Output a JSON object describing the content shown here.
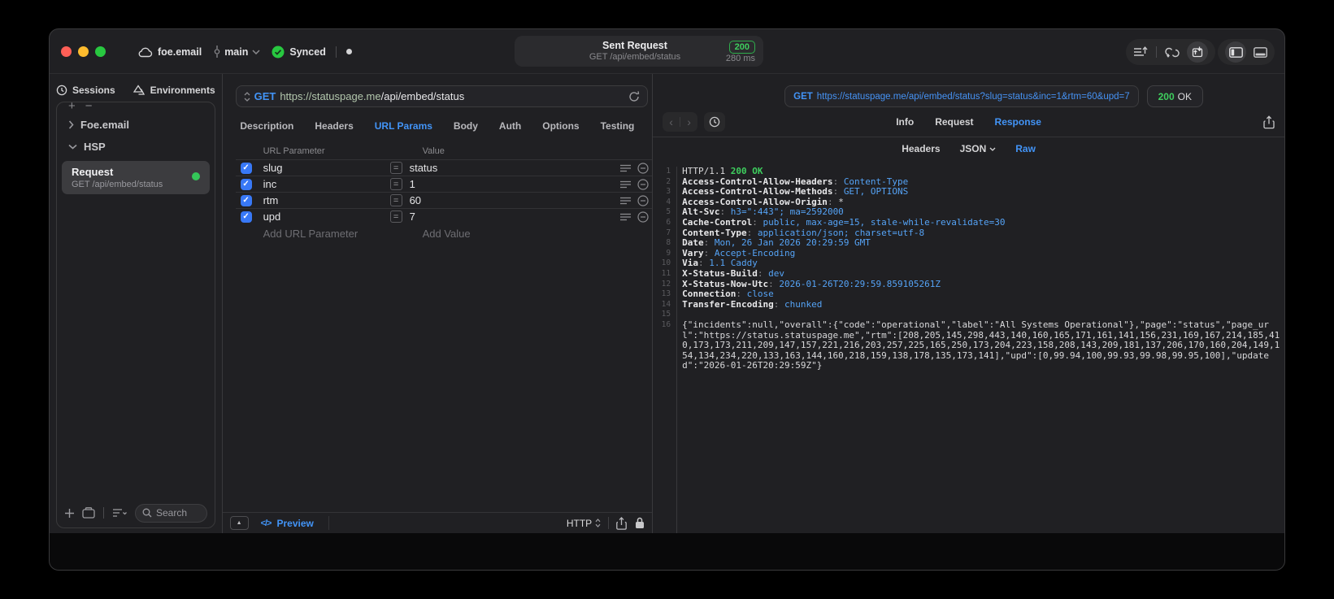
{
  "titlebar": {
    "workspace": "foe.email",
    "branch": "main",
    "sync_status": "Synced",
    "request_title": "Sent Request",
    "request_subtitle": "GET /api/embed/status",
    "status_code": "200",
    "duration": "280 ms"
  },
  "sidebar": {
    "tabs": [
      {
        "label": "Sessions"
      },
      {
        "label": "Environments"
      }
    ],
    "add_label": "+",
    "remove_label": "−",
    "tree": [
      {
        "label": "Foe.email"
      },
      {
        "label": "HSP"
      }
    ],
    "selected_request": {
      "title": "Request",
      "subtitle": "GET /api/embed/status"
    },
    "search_placeholder": "Search"
  },
  "request_panel": {
    "method": "GET",
    "url_host": "https://statuspage.me",
    "url_path": "/api/embed/status",
    "tabs": [
      "Description",
      "Headers",
      "URL Params",
      "Body",
      "Auth",
      "Options",
      "Testing"
    ],
    "active_tab": "URL Params",
    "table": {
      "columns": [
        "URL Parameter",
        "Value"
      ],
      "rows": [
        {
          "name": "slug",
          "value": "status",
          "enabled": true
        },
        {
          "name": "inc",
          "value": "1",
          "enabled": true
        },
        {
          "name": "rtm",
          "value": "60",
          "enabled": true
        },
        {
          "name": "upd",
          "value": "7",
          "enabled": true
        }
      ],
      "add_name_placeholder": "Add URL Parameter",
      "add_value_placeholder": "Add Value"
    },
    "footer": {
      "preview_label": "Preview",
      "code_glyph": "</>",
      "protocol": "HTTP"
    }
  },
  "response_panel": {
    "method": "GET",
    "url": "https://statuspage.me/api/embed/status?slug=status&inc=1&rtm=60&upd=7",
    "status_code": "200",
    "status_text": "OK",
    "tabs": [
      "Info",
      "Request",
      "Response"
    ],
    "active_tab": "Response",
    "subtabs": [
      "Headers",
      "JSON",
      "Raw"
    ],
    "active_subtab": "Raw",
    "body_lines": [
      {
        "n": "1",
        "segs": [
          [
            "HTTP/1.1 ",
            "plain"
          ],
          [
            "200 OK",
            "green"
          ]
        ]
      },
      {
        "n": "2",
        "segs": [
          [
            "Access-Control-Allow-Headers",
            "name"
          ],
          [
            ": ",
            "dim"
          ],
          [
            "Content-Type",
            "val"
          ]
        ]
      },
      {
        "n": "3",
        "segs": [
          [
            "Access-Control-Allow-Methods",
            "name"
          ],
          [
            ": ",
            "dim"
          ],
          [
            "GET, OPTIONS",
            "val"
          ]
        ]
      },
      {
        "n": "4",
        "segs": [
          [
            "Access-Control-Allow-Origin",
            "name"
          ],
          [
            ": ",
            "dim"
          ],
          [
            "*",
            "plain"
          ]
        ]
      },
      {
        "n": "5",
        "segs": [
          [
            "Alt-Svc",
            "name"
          ],
          [
            ": ",
            "dim"
          ],
          [
            "h3=\":443\"; ma=2592000",
            "val"
          ]
        ]
      },
      {
        "n": "6",
        "segs": [
          [
            "Cache-Control",
            "name"
          ],
          [
            ": ",
            "dim"
          ],
          [
            "public, max-age=15, stale-while-revalidate=30",
            "val"
          ]
        ]
      },
      {
        "n": "7",
        "segs": [
          [
            "Content-Type",
            "name"
          ],
          [
            ": ",
            "dim"
          ],
          [
            "application/json; charset=utf-8",
            "val"
          ]
        ]
      },
      {
        "n": "8",
        "segs": [
          [
            "Date",
            "name"
          ],
          [
            ": ",
            "dim"
          ],
          [
            "Mon, 26 Jan 2026 20:29:59 GMT",
            "val"
          ]
        ]
      },
      {
        "n": "9",
        "segs": [
          [
            "Vary",
            "name"
          ],
          [
            ": ",
            "dim"
          ],
          [
            "Accept-Encoding",
            "val"
          ]
        ]
      },
      {
        "n": "10",
        "segs": [
          [
            "Via",
            "name"
          ],
          [
            ": ",
            "dim"
          ],
          [
            "1.1 Caddy",
            "val"
          ]
        ]
      },
      {
        "n": "11",
        "segs": [
          [
            "X-Status-Build",
            "name"
          ],
          [
            ": ",
            "dim"
          ],
          [
            "dev",
            "val"
          ]
        ]
      },
      {
        "n": "12",
        "segs": [
          [
            "X-Status-Now-Utc",
            "name"
          ],
          [
            ": ",
            "dim"
          ],
          [
            "2026-01-26T20:29:59.859105261Z",
            "val"
          ]
        ]
      },
      {
        "n": "13",
        "segs": [
          [
            "Connection",
            "name"
          ],
          [
            ": ",
            "dim"
          ],
          [
            "close",
            "val"
          ]
        ]
      },
      {
        "n": "14",
        "segs": [
          [
            "Transfer-Encoding",
            "name"
          ],
          [
            ": ",
            "dim"
          ],
          [
            "chunked",
            "val"
          ]
        ]
      },
      {
        "n": "15",
        "segs": []
      },
      {
        "n": "16",
        "segs": [
          [
            "{\"incidents\":null,\"overall\":{\"code\":\"operational\",\"label\":\"All Systems Operational\"},\"page\":\"status\",\"page_url\":\"https://status.statuspage.me\",\"rtm\":[208,205,145,298,443,140,160,165,171,161,141,156,231,169,167,214,185,410,173,173,211,209,147,157,221,216,203,257,225,165,250,173,204,223,158,208,143,209,181,137,206,170,160,204,149,154,134,234,220,133,163,144,160,218,159,138,178,135,173,141],\"upd\":[0,99.94,100,99.93,99.98,99.95,100],\"updated\":\"2026-01-26T20:29:59Z\"}",
            "plain"
          ]
        ]
      }
    ]
  },
  "colors": {
    "accent_blue": "#4294f7",
    "status_green": "#3ecf5e",
    "checkbox_blue": "#3878f6",
    "window_bg": "#202023"
  }
}
